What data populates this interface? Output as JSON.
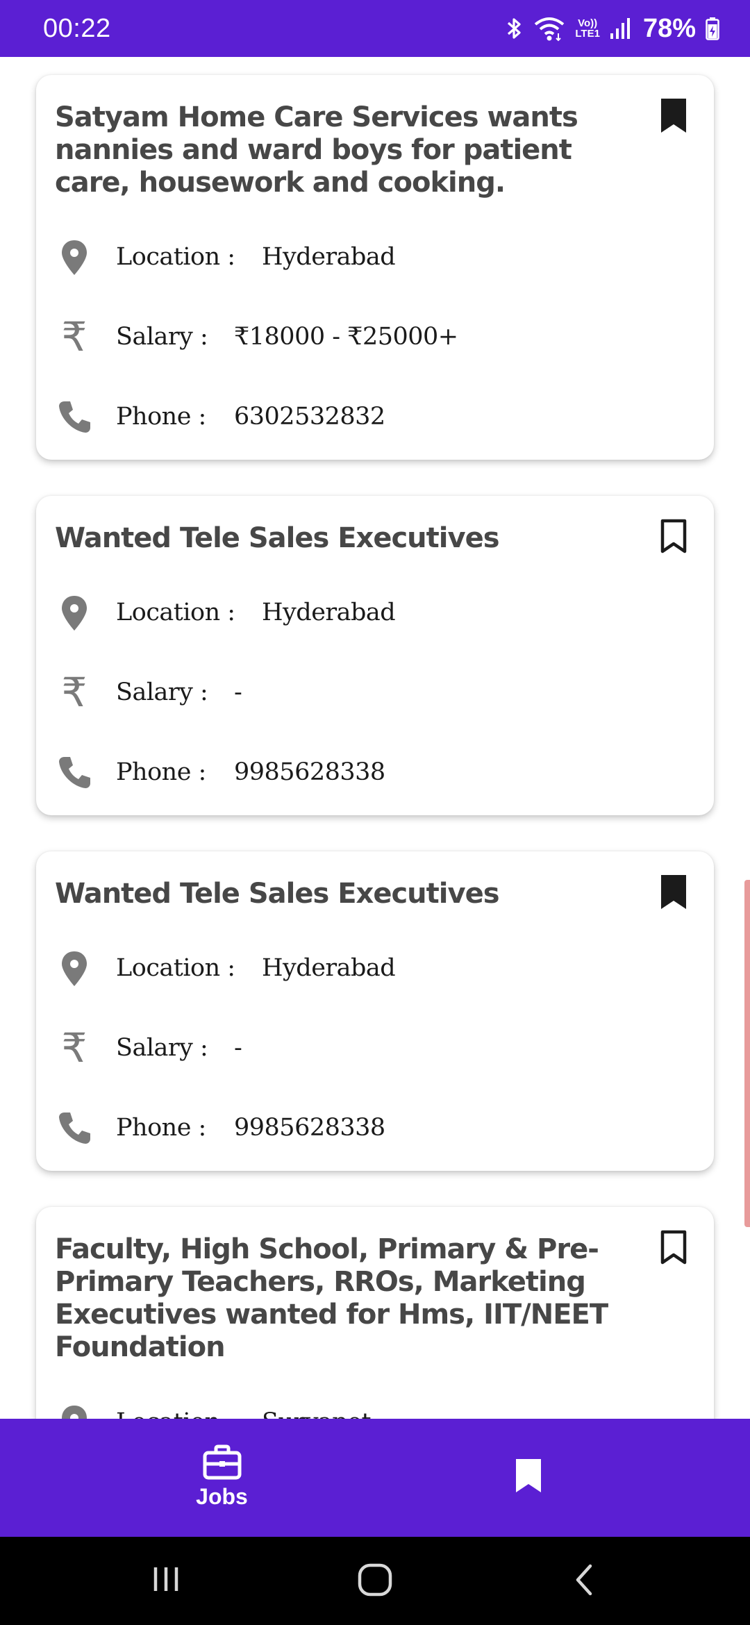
{
  "status_bar": {
    "time": "00:22",
    "network_label_top": "Vo))",
    "network_label_bottom": "LTE1",
    "battery": "78%"
  },
  "jobs": [
    {
      "title": "Satyam Home Care Services wants nannies and ward boys for patient care, housework and cooking.",
      "bookmarked": true,
      "location_label": "Location :",
      "location": "Hyderabad",
      "salary_label": "Salary :",
      "salary": "₹18000 - ₹25000+",
      "phone_label": "Phone :",
      "phone": "6302532832"
    },
    {
      "title": "Wanted Tele Sales Executives",
      "bookmarked": false,
      "location_label": "Location :",
      "location": "Hyderabad",
      "salary_label": "Salary :",
      "salary": "-",
      "phone_label": "Phone :",
      "phone": "9985628338"
    },
    {
      "title": "Wanted Tele Sales Executives",
      "bookmarked": true,
      "location_label": "Location :",
      "location": "Hyderabad",
      "salary_label": "Salary :",
      "salary": "-",
      "phone_label": "Phone :",
      "phone": "9985628338"
    },
    {
      "title": "Faculty, High School, Primary & Pre-Primary Teachers, RROs, Marketing Executives wanted for Hms, IIT/NEET Foundation",
      "bookmarked": false,
      "location_label": "Location :",
      "location": "Suryapet"
    }
  ],
  "bottom_nav": {
    "jobs_label": "Jobs",
    "jobs_icon": "briefcase-icon",
    "saved_icon": "bookmark-icon"
  },
  "colors": {
    "primary": "#5b1fd3",
    "title_text": "#474747",
    "icon_gray": "#7a7a7a"
  }
}
